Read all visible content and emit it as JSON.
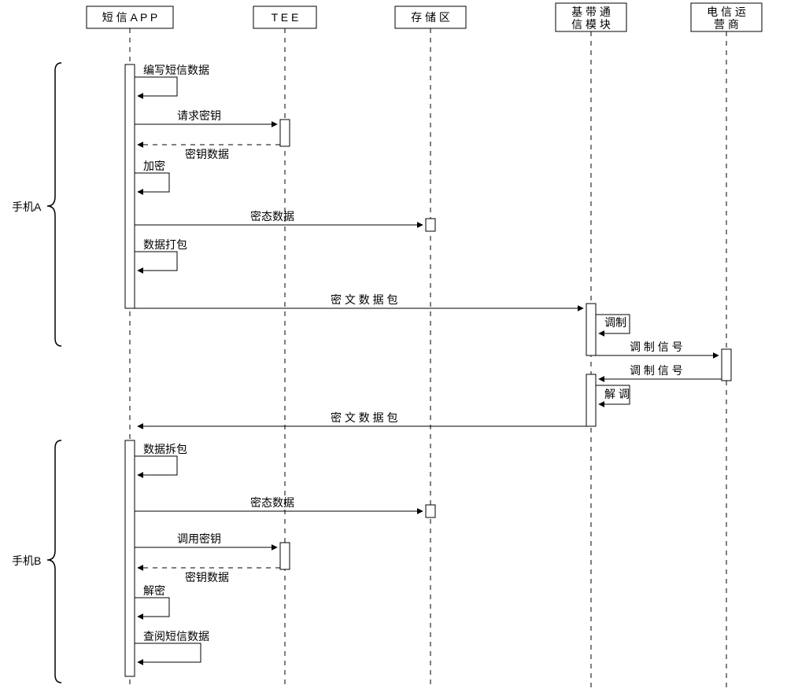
{
  "participants": [
    {
      "id": "app",
      "label": "短 信 A P P"
    },
    {
      "id": "tee",
      "label": "T E E"
    },
    {
      "id": "storage",
      "label": "存 储 区"
    },
    {
      "id": "baseband",
      "label": "基 带 通\n信 模 块"
    },
    {
      "id": "carrier",
      "label": "电 信 运\n营 商"
    }
  ],
  "phones": [
    {
      "id": "phoneA",
      "label": "手机A"
    },
    {
      "id": "phoneB",
      "label": "手机B"
    }
  ],
  "messages": {
    "compose": "编写短信数据",
    "request_key": "请求密钥",
    "key_data": "密钥数据",
    "encrypt": "加密",
    "cipher_state": "密态数据",
    "pack": "数据打包",
    "cipher_pkt": "密 文 数 据 包",
    "modulate": "调制",
    "modulated_signal": "调 制 信 号",
    "demodulate": "解 调",
    "unpack": "数据拆包",
    "invoke_key": "调用密钥",
    "decrypt": "解密",
    "view": "查阅短信数据"
  }
}
